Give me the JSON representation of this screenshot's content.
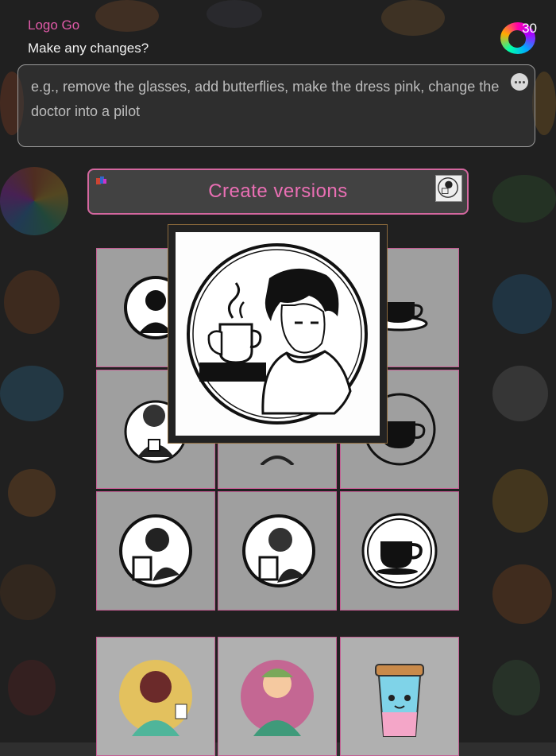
{
  "header": {
    "app_title": "Logo Go",
    "prompt_question": "Make any changes?",
    "credits_count": "30"
  },
  "prompt": {
    "placeholder": "e.g., remove the glasses, add butterflies, make the dress pink, change the doctor into a pilot"
  },
  "create_button": {
    "label": "Create versions"
  },
  "colors": {
    "accent": "#ea6fb4",
    "accent_border": "#d4679f",
    "background": "#2f2f2f"
  },
  "icons": {
    "credits": "credits-icon",
    "more": "more-options-icon",
    "preview": "selected-logo-thumbnail"
  }
}
